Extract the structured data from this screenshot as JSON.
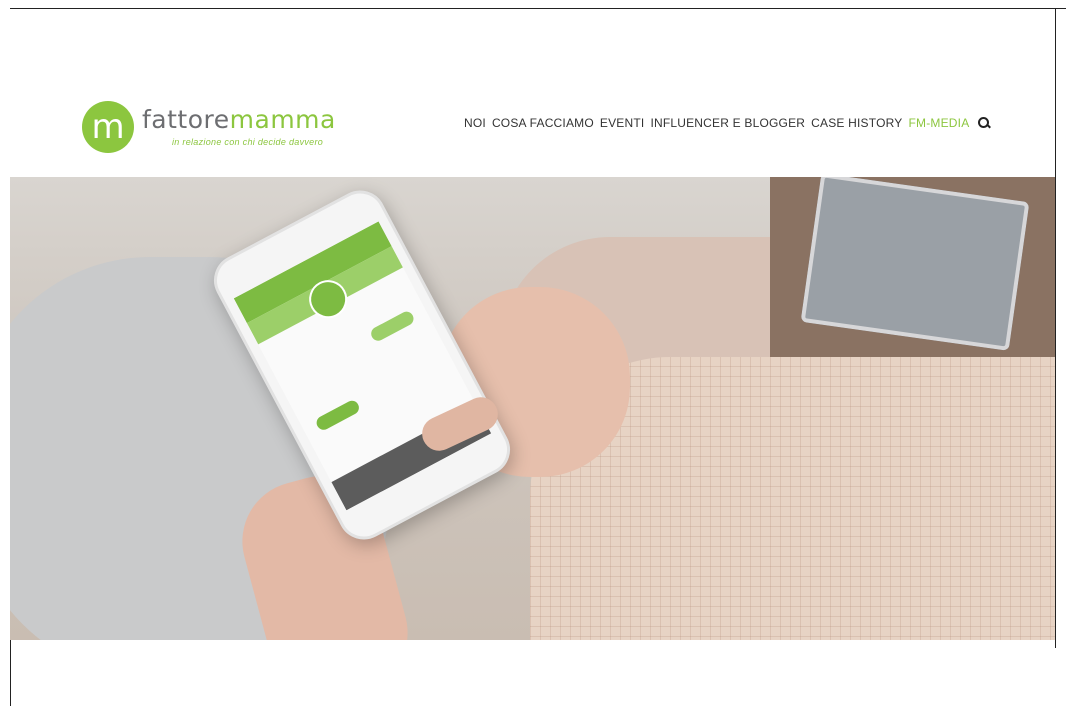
{
  "header": {
    "logo_letter": "m",
    "logo_word_part1": "fattore",
    "logo_word_part2": "mamma",
    "tagline": "in relazione con chi decide davvero"
  },
  "nav": {
    "items": [
      {
        "label": "NOI"
      },
      {
        "label": "COSA FACCIAMO"
      },
      {
        "label": "EVENTI"
      },
      {
        "label": "INFLUENCER E BLOGGER"
      },
      {
        "label": "CASE HISTORY"
      },
      {
        "label": "FM-MEDIA",
        "active": true
      }
    ],
    "search_icon": "search-icon"
  },
  "colors": {
    "brand_green": "#8cc63f",
    "nav_text": "#333333"
  }
}
